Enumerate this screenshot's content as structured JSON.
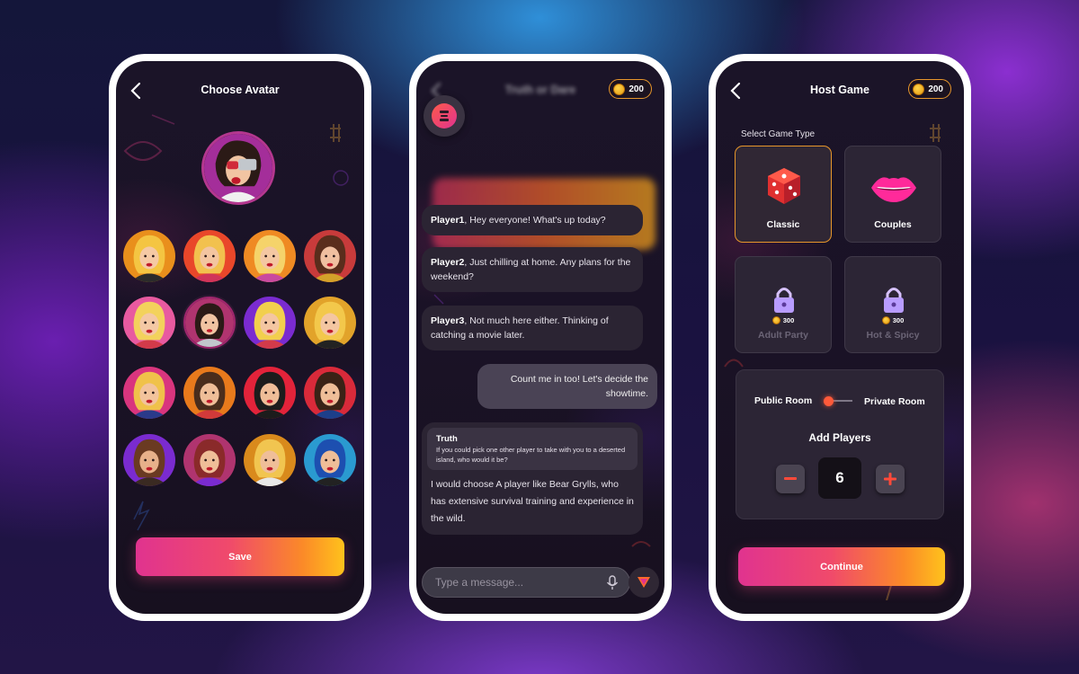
{
  "screens": {
    "avatar": {
      "title": "Choose Avatar",
      "save_label": "Save",
      "avatars": [
        {
          "hair": "#f4c542",
          "skin": "#f5c9a4",
          "bg": "#e98f1c",
          "accent": "#2b2b2b"
        },
        {
          "hair": "#f2c14e",
          "skin": "#f3c5a0",
          "bg": "#e9472a",
          "accent": "#d0345a"
        },
        {
          "hair": "#f5d36a",
          "skin": "#f4c7a2",
          "bg": "#ef8a23",
          "accent": "#c94a9f"
        },
        {
          "hair": "#5a2d1c",
          "skin": "#f0bfa0",
          "bg": "#c83b3b",
          "accent": "#d4a12a"
        },
        {
          "hair": "#f3d25c",
          "skin": "#f4c8a4",
          "bg": "#e85aa0",
          "accent": "#d23a4a"
        },
        {
          "hair": "#2b1a16",
          "skin": "#f1c4a2",
          "bg": "#b0346f",
          "accent": "#c2c7cc"
        },
        {
          "hair": "#f2cf4d",
          "skin": "#f4c6a1",
          "bg": "#7a2bd0",
          "accent": "#d23a4a"
        },
        {
          "hair": "#f3c84b",
          "skin": "#f4c6a1",
          "bg": "#e2a32a",
          "accent": "#222"
        },
        {
          "hair": "#f0c24a",
          "skin": "#f2c39c",
          "bg": "#d9357e",
          "accent": "#2a3a8a"
        },
        {
          "hair": "#4a2d1c",
          "skin": "#efbe98",
          "bg": "#e87a1c",
          "accent": "#d23a3a"
        },
        {
          "hair": "#1c1c1c",
          "skin": "#efbe98",
          "bg": "#e2233a",
          "accent": "#1c1c1c"
        },
        {
          "hair": "#3a2216",
          "skin": "#efbe98",
          "bg": "#d92a3a",
          "accent": "#1d3f8a"
        },
        {
          "hair": "#6a3a22",
          "skin": "#e7b08a",
          "bg": "#7a2bd0",
          "accent": "#3a2a22"
        },
        {
          "hair": "#8a2a2a",
          "skin": "#efbe98",
          "bg": "#b0346f",
          "accent": "#7a2bd0"
        },
        {
          "hair": "#f1c550",
          "skin": "#efbe98",
          "bg": "#d98a1c",
          "accent": "#e8e8e8"
        },
        {
          "hair": "#1d4fb0",
          "skin": "#efbe98",
          "bg": "#2a9ad0",
          "accent": "#222"
        }
      ]
    },
    "chat": {
      "blurred_title": "Truth or Dare",
      "coins": "200",
      "messages": [
        {
          "sender": "Player1",
          "text": ", Hey everyone! What's up today?"
        },
        {
          "sender": "Player2",
          "text": ", Just chilling at home. Any plans for the weekend?"
        },
        {
          "sender": "Player3",
          "text": ", Not much here either. Thinking of catching a movie later."
        }
      ],
      "my_message": "Count me in too! Let's decide the showtime.",
      "truth": {
        "label": "Truth",
        "question": "If you could pick one other player to take with you to a deserted island, who would it be?",
        "answer": "I would choose  A player like Bear Grylls, who has extensive survival training and experience in the wild."
      },
      "input_placeholder": "Type a message..."
    },
    "host": {
      "title": "Host Game",
      "coins": "200",
      "select_label": "Select Game Type",
      "game_types": [
        {
          "label": "Classic",
          "selected": true,
          "locked": false
        },
        {
          "label": "Couples",
          "selected": false,
          "locked": false
        },
        {
          "label": "Adult Party",
          "selected": false,
          "locked": true,
          "price": "300"
        },
        {
          "label": "Hot & Spicy",
          "selected": false,
          "locked": true,
          "price": "300"
        }
      ],
      "public_label": "Public Room",
      "private_label": "Private Room",
      "add_players_label": "Add Players",
      "players_count": "6",
      "continue_label": "Continue"
    }
  }
}
